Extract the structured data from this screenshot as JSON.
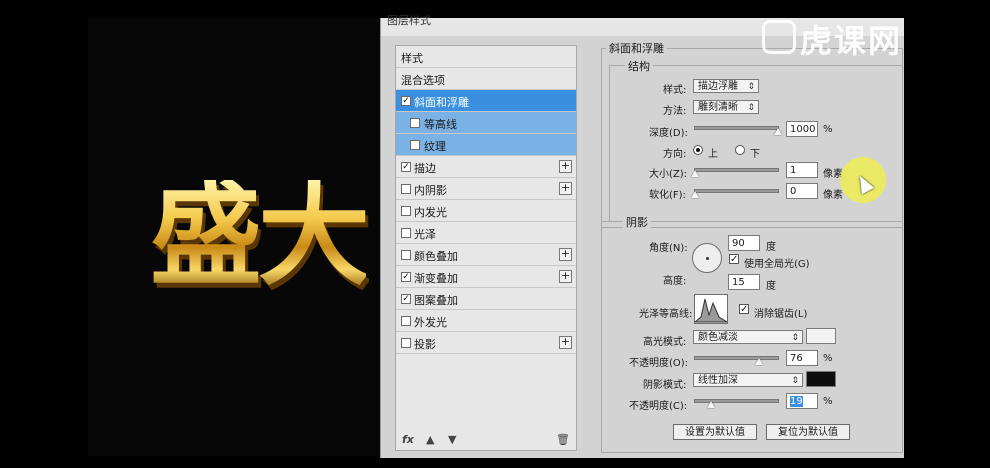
{
  "dialog": {
    "title": "图层样式",
    "styles_list": [
      {
        "label": "样式",
        "checkbox": false,
        "checked": false,
        "plus": false,
        "state": "normal"
      },
      {
        "label": "混合选项",
        "checkbox": false,
        "checked": false,
        "plus": false,
        "state": "normal"
      },
      {
        "label": "斜面和浮雕",
        "checkbox": true,
        "checked": true,
        "plus": false,
        "state": "selected"
      },
      {
        "label": "等高线",
        "checkbox": true,
        "checked": false,
        "plus": false,
        "state": "sub"
      },
      {
        "label": "纹理",
        "checkbox": true,
        "checked": false,
        "plus": false,
        "state": "sub"
      },
      {
        "label": "描边",
        "checkbox": true,
        "checked": true,
        "plus": true,
        "state": "normal"
      },
      {
        "label": "内阴影",
        "checkbox": true,
        "checked": false,
        "plus": true,
        "state": "normal"
      },
      {
        "label": "内发光",
        "checkbox": true,
        "checked": false,
        "plus": false,
        "state": "normal"
      },
      {
        "label": "光泽",
        "checkbox": true,
        "checked": false,
        "plus": false,
        "state": "normal"
      },
      {
        "label": "颜色叠加",
        "checkbox": true,
        "checked": false,
        "plus": true,
        "state": "normal"
      },
      {
        "label": "渐变叠加",
        "checkbox": true,
        "checked": true,
        "plus": true,
        "state": "normal"
      },
      {
        "label": "图案叠加",
        "checkbox": true,
        "checked": true,
        "plus": false,
        "state": "normal"
      },
      {
        "label": "外发光",
        "checkbox": true,
        "checked": false,
        "plus": false,
        "state": "normal"
      },
      {
        "label": "投影",
        "checkbox": true,
        "checked": false,
        "plus": true,
        "state": "normal"
      }
    ],
    "footer": {
      "fx": "fx",
      "up_icon": "arrow-up-icon",
      "down_icon": "arrow-down-icon",
      "trash_icon": "trash-icon"
    },
    "bevel": {
      "section_title": "斜面和浮雕",
      "structure_title": "结构",
      "style_label": "样式:",
      "style_value": "描边浮雕",
      "technique_label": "方法:",
      "technique_value": "雕刻清晰",
      "depth_label": "深度(D):",
      "depth_value": "1000",
      "depth_unit": "%",
      "depth_slider": 1.0,
      "direction_label": "方向:",
      "direction_up": "上",
      "direction_down": "下",
      "size_label": "大小(Z):",
      "size_value": "1",
      "size_unit": "像素",
      "soften_label": "软化(F):",
      "soften_value": "0",
      "soften_unit": "像素"
    },
    "shading": {
      "title": "阴影",
      "angle_label": "角度(N):",
      "angle_value": "90",
      "angle_unit": "度",
      "global_light_label": "使用全局光(G)",
      "altitude_label": "高度:",
      "altitude_value": "15",
      "altitude_unit": "度",
      "gloss_label": "光泽等高线:",
      "antialias_label": "消除锯齿(L)",
      "highlight_mode_label": "高光模式:",
      "highlight_mode_value": "颜色减淡",
      "highlight_color": "#f2f2f2",
      "highlight_opacity_label": "不透明度(O):",
      "highlight_opacity_value": "76",
      "highlight_opacity_unit": "%",
      "highlight_opacity_slider": 0.76,
      "shadow_mode_label": "阴影模式:",
      "shadow_mode_value": "线性加深",
      "shadow_color": "#0d0d0d",
      "shadow_opacity_label": "不透明度(C):",
      "shadow_opacity_value": "19",
      "shadow_opacity_unit": "%",
      "shadow_opacity_slider": 0.19
    },
    "buttons": {
      "set_default": "设置为默认值",
      "reset_default": "复位为默认值"
    }
  },
  "canvas": {
    "text": "盛大"
  },
  "watermark": {
    "text": "虎课网"
  }
}
